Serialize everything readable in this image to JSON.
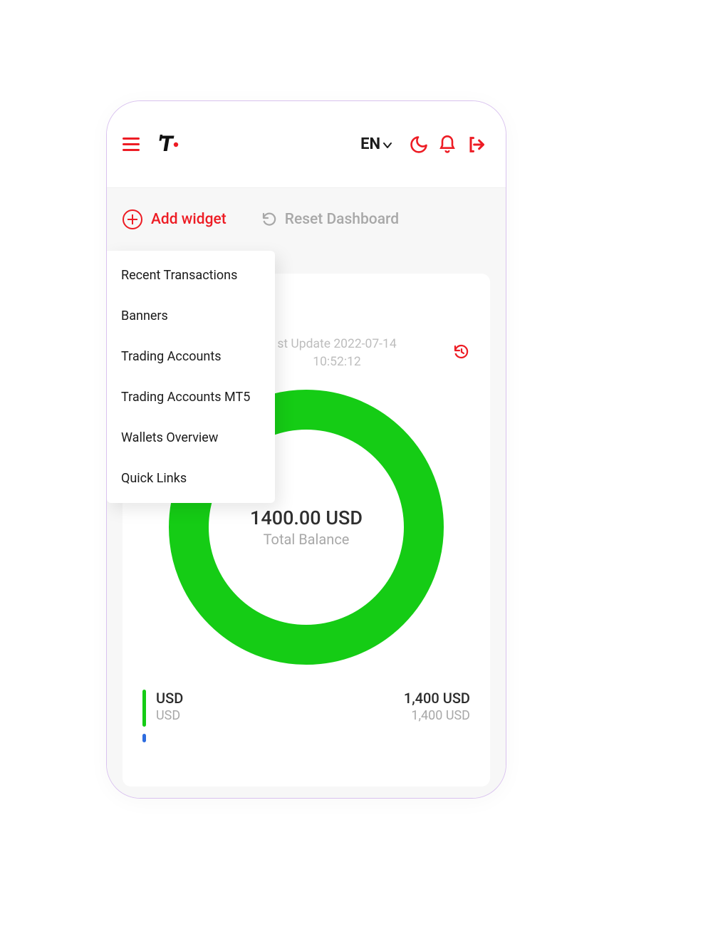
{
  "header": {
    "lang": "EN"
  },
  "actions": {
    "add_widget_label": "Add widget",
    "reset_label": "Reset Dashboard"
  },
  "dropdown": {
    "items": [
      "Recent Transactions",
      "Banners",
      "Trading Accounts",
      "Trading Accounts MT5",
      "Wallets Overview",
      "Quick Links"
    ]
  },
  "card": {
    "partial_title_visible": "v",
    "last_update_line1": "st Update 2022-07-14",
    "last_update_line2": "10:52:12",
    "total_value": "1400.00 USD",
    "total_label": "Total Balance",
    "legend": [
      {
        "code": "USD",
        "sub": "USD",
        "amount": "1,400 USD",
        "amount_sub": "1,400 USD"
      }
    ]
  },
  "chart_data": {
    "type": "pie",
    "title": "Total Balance",
    "series": [
      {
        "name": "USD",
        "value": 1400,
        "color": "#15cc15"
      }
    ],
    "total": 1400,
    "currency": "USD"
  }
}
